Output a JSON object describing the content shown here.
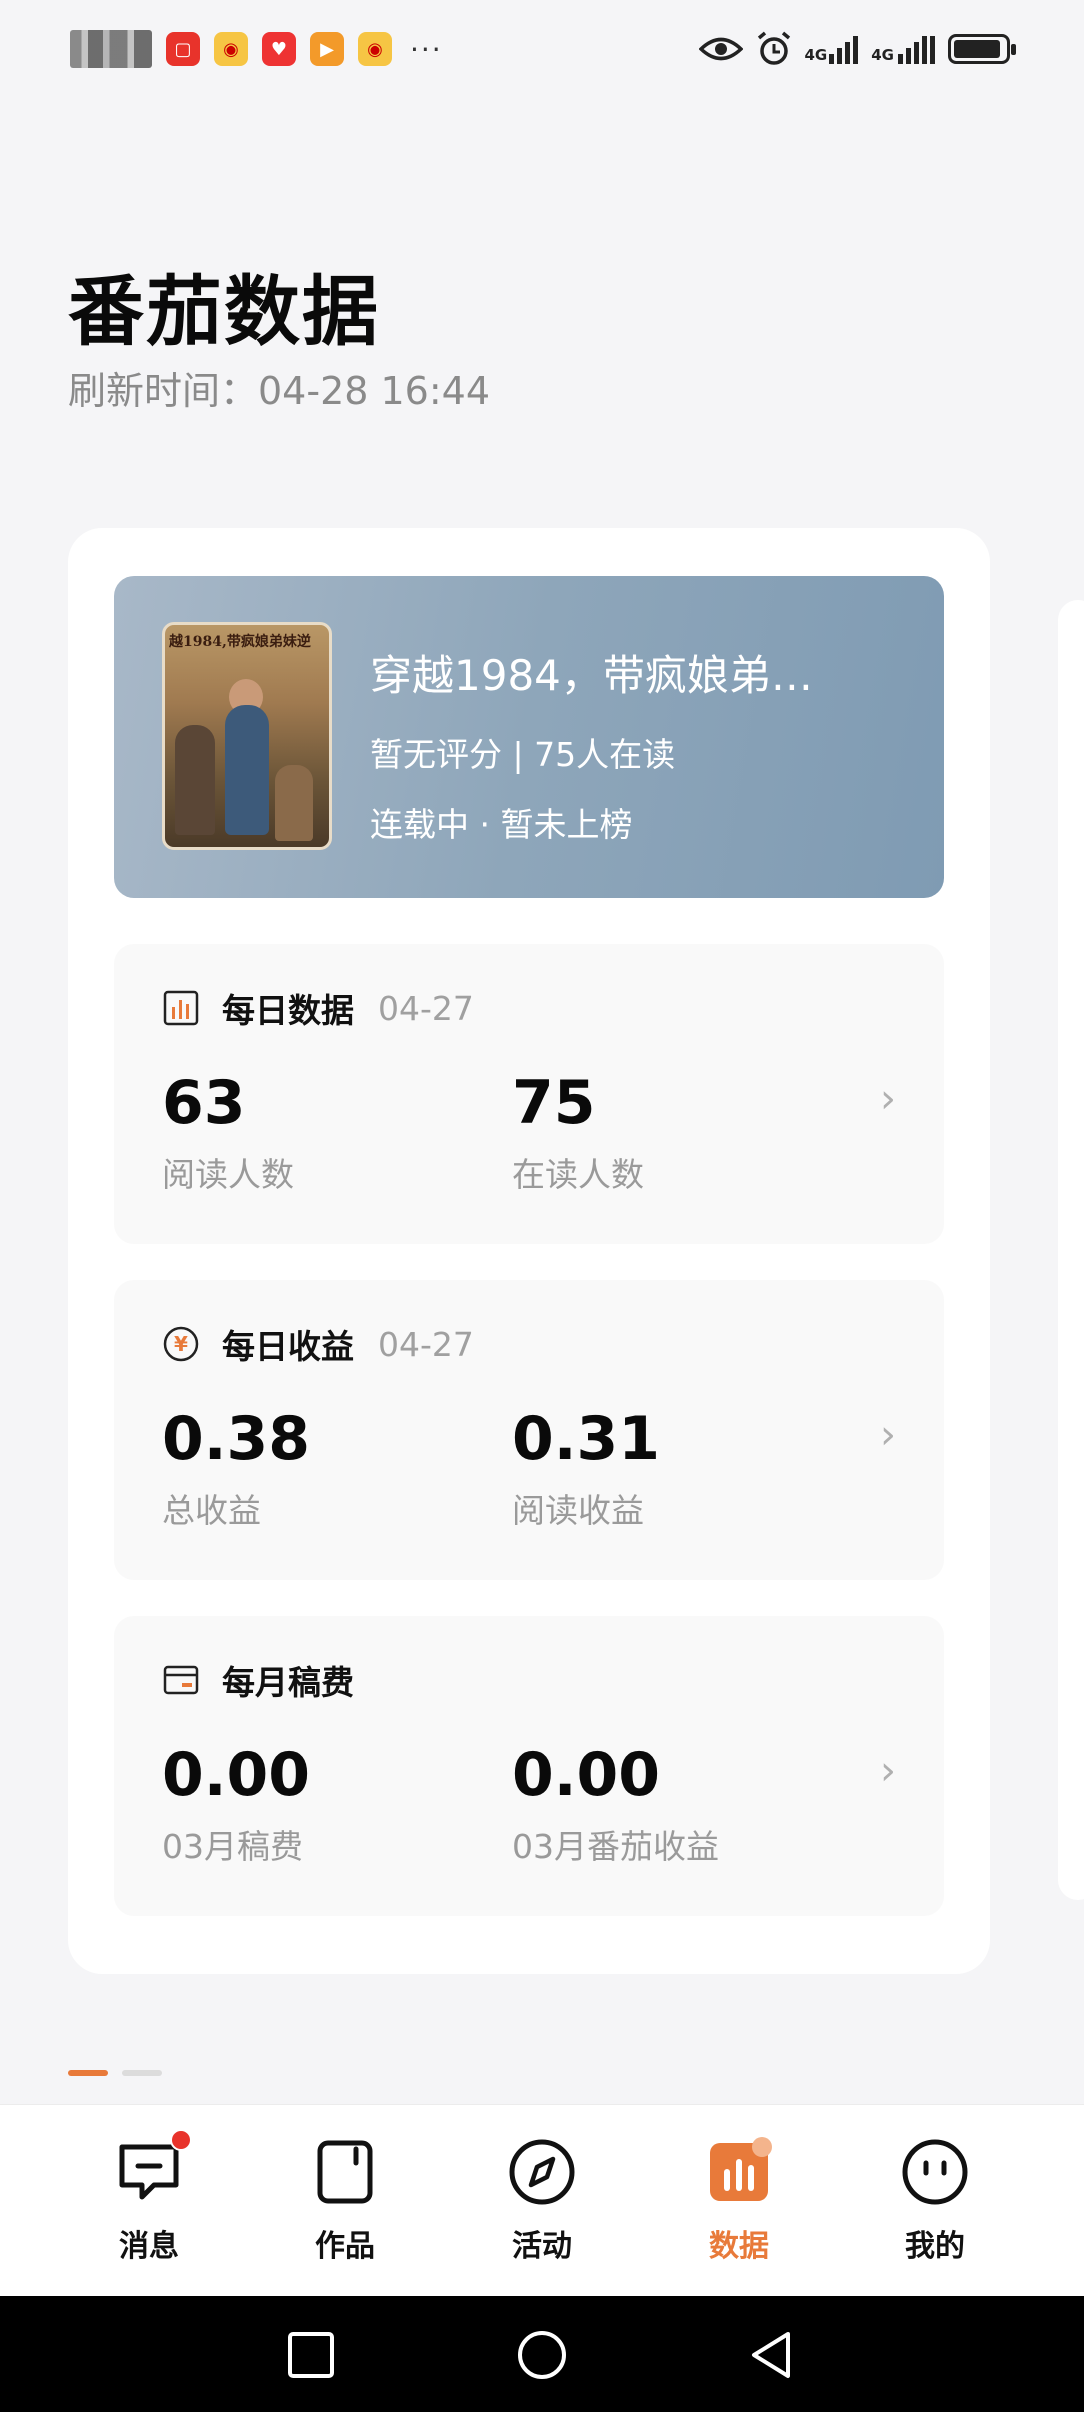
{
  "status_bar": {
    "app_icons": [
      "huawei-app-icon",
      "weibo-icon",
      "weibo-icon",
      "heart-app-icon",
      "video-app-icon",
      "weibo-icon"
    ],
    "overflow": "···",
    "signal1": "4G",
    "signal2": "4G"
  },
  "header": {
    "title": "番茄数据",
    "refresh_label": "刷新时间：04-28 16:44"
  },
  "book": {
    "cover_title": "越1984,带疯娘弟妹逆",
    "name": "穿越1984，带疯娘弟…",
    "meta": "暂无评分 | 75人在读",
    "status": "连载中 · 暂未上榜"
  },
  "daily_data": {
    "label": "每日数据",
    "date": "04-27",
    "value1": "63",
    "label1": "阅读人数",
    "value2": "75",
    "label2": "在读人数"
  },
  "daily_income": {
    "label": "每日收益",
    "date": "04-27",
    "value1": "0.38",
    "label1": "总收益",
    "value2": "0.31",
    "label2": "阅读收益"
  },
  "monthly_fee": {
    "label": "每月稿费",
    "value1": "0.00",
    "label1": "03月稿费",
    "value2": "0.00",
    "label2": "03月番茄收益"
  },
  "tabs": [
    {
      "label": "消息",
      "icon": "message-icon"
    },
    {
      "label": "作品",
      "icon": "works-icon"
    },
    {
      "label": "活动",
      "icon": "compass-icon"
    },
    {
      "label": "数据",
      "icon": "chart-icon"
    },
    {
      "label": "我的",
      "icon": "profile-icon"
    }
  ],
  "colors": {
    "accent": "#e87a3a",
    "badge": "#e8332b",
    "book_card": "#8ea6ba"
  }
}
